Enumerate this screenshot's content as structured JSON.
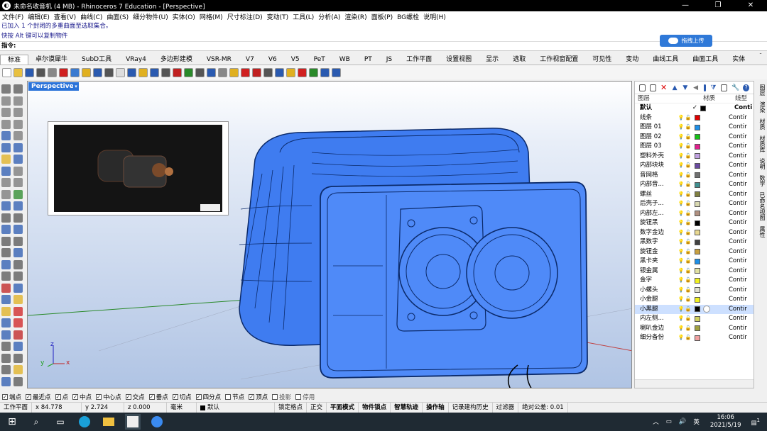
{
  "window": {
    "title": "未命名收音机 (4 MB) - Rhinoceros 7 Education - [Perspective]"
  },
  "menu": [
    "文件(F)",
    "编辑(E)",
    "查看(V)",
    "曲线(C)",
    "曲面(S)",
    "细分物件(U)",
    "实体(O)",
    "网格(M)",
    "尺寸标注(D)",
    "变动(T)",
    "工具(L)",
    "分析(A)",
    "渲染(R)",
    "面板(P)",
    "BG螺栓",
    "说明(H)"
  ],
  "command": {
    "line1": "已加入 1 个封闭的多重曲面至选取集合。",
    "line2": "快按 Alt 键可以复制物件",
    "prompt": "指令:"
  },
  "upload_label": "拖拽上传",
  "tabs": [
    "标准",
    "卓尔谟犀牛",
    "SubD工具",
    "VRay4",
    "多边形建模",
    "VSR-MR",
    "V7",
    "V6",
    "V5",
    "PeT",
    "WB",
    "PT",
    "JS",
    "工作平面",
    "设置视图",
    "显示",
    "选取",
    "工作视窗配置",
    "可见性",
    "变动",
    "曲线工具",
    "曲面工具",
    "实体"
  ],
  "viewport": {
    "label": "Perspective"
  },
  "axes": {
    "x": "x",
    "y": "y",
    "z": "z"
  },
  "layers": {
    "head": {
      "name": "图层",
      "material": "材质",
      "linetype": "线型"
    },
    "rows": [
      {
        "name": "默认",
        "color": "#000000",
        "lt": "Conti",
        "check": "✓"
      },
      {
        "name": "线条",
        "color": "#e00000",
        "lt": "Contir"
      },
      {
        "name": "图层 01",
        "color": "#1d8fe8",
        "lt": "Contir"
      },
      {
        "name": "图层 02",
        "color": "#16c016",
        "lt": "Contir"
      },
      {
        "name": "图层 03",
        "color": "#e0208c",
        "lt": "Contir"
      },
      {
        "name": "塑料外壳",
        "color": "#c0a0e0",
        "lt": "Contir"
      },
      {
        "name": "内部块块",
        "color": "#6a4aa0",
        "lt": "Contir"
      },
      {
        "name": "音网格",
        "color": "#707070",
        "lt": "Contir"
      },
      {
        "name": "内部音...",
        "color": "#409090",
        "lt": "Contir"
      },
      {
        "name": "螺丝",
        "color": "#808040",
        "lt": "Contir"
      },
      {
        "name": "后壳子...",
        "color": "#d8d8b0",
        "lt": "Contir"
      },
      {
        "name": "内部左...",
        "color": "#b09080",
        "lt": "Contir"
      },
      {
        "name": "旋钮黑",
        "color": "#000000",
        "lt": "Contir"
      },
      {
        "name": "数字金边",
        "color": "#e8d890",
        "lt": "Contir"
      },
      {
        "name": "黑数字",
        "color": "#404040",
        "lt": "Contir"
      },
      {
        "name": "旋钮金",
        "color": "#c8a040",
        "lt": "Contir"
      },
      {
        "name": "黑卡夹",
        "color": "#1d8fe8",
        "lt": "Contir"
      },
      {
        "name": "银金属",
        "color": "#e0e0a0",
        "lt": "Contir"
      },
      {
        "name": "金字",
        "color": "#f0f020",
        "lt": "Contir"
      },
      {
        "name": "小螺头",
        "color": "#e0e0d0",
        "lt": "Contir"
      },
      {
        "name": "小金腿",
        "color": "#f0f020",
        "lt": "Contir"
      },
      {
        "name": "小黑腿",
        "color": "#000000",
        "lt": "Contir",
        "selected": true
      },
      {
        "name": "内左侧...",
        "color": "#d0d060",
        "lt": "Contir"
      },
      {
        "name": "喇叭金边",
        "color": "#a0a040",
        "lt": "Contir"
      },
      {
        "name": "细分备份",
        "color": "#f0a0a0",
        "lt": "Contir"
      }
    ]
  },
  "side_tabs": [
    "图层",
    "渲染",
    "材质",
    "材质库",
    "说明",
    "数字",
    "已命名视图",
    "属性"
  ],
  "osnap": [
    {
      "label": "端点",
      "checked": true
    },
    {
      "label": "最近点",
      "checked": true
    },
    {
      "label": "点",
      "checked": true
    },
    {
      "label": "中点",
      "checked": true
    },
    {
      "label": "中心点",
      "checked": true
    },
    {
      "label": "交点",
      "checked": true
    },
    {
      "label": "垂点",
      "checked": true
    },
    {
      "label": "切点",
      "checked": true
    },
    {
      "label": "四分点",
      "checked": true
    },
    {
      "label": "节点",
      "checked": false
    },
    {
      "label": "顶点",
      "checked": true
    },
    {
      "label": "投影",
      "checked": false
    },
    {
      "label": "停用",
      "checked": false
    }
  ],
  "status": {
    "plane": "工作平面",
    "x": "x 84.778",
    "y": "y 2.724",
    "z": "z 0.000",
    "unit": "毫米",
    "layer": "默认",
    "items": [
      "锁定格点",
      "正交",
      "平面模式",
      "物件锁点",
      "智慧轨迹",
      "操作轴",
      "记录建构历史",
      "过滤器",
      "绝对公差: 0.01"
    ]
  },
  "taskbar": {
    "lang": "英",
    "time": "16:06",
    "date": "2021/5/19",
    "notif": "1"
  }
}
